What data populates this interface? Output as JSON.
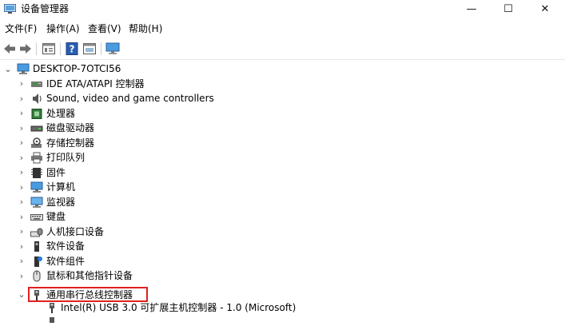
{
  "window": {
    "title": "设备管理器",
    "minimize_glyph": "—",
    "maximize_glyph": "☐",
    "close_glyph": "✕"
  },
  "menu": {
    "items": [
      "文件(F)",
      "操作(A)",
      "查看(V)",
      "帮助(H)"
    ]
  },
  "toolbar": {
    "buttons": [
      "back-arrow-icon",
      "forward-arrow-icon",
      "properties-icon",
      "help-icon",
      "view-icon",
      "monitor-icon"
    ]
  },
  "tree": {
    "root": {
      "label": "DESKTOP-7OTCI56",
      "expanded": true,
      "icon": "computer-icon"
    },
    "categories": [
      {
        "label": "IDE ATA/ATAPI 控制器",
        "icon": "ide-controller-icon"
      },
      {
        "label": "Sound, video and game controllers",
        "icon": "speaker-icon"
      },
      {
        "label": "处理器",
        "icon": "processor-icon"
      },
      {
        "label": "磁盘驱动器",
        "icon": "disk-drive-icon"
      },
      {
        "label": "存储控制器",
        "icon": "storage-controller-icon"
      },
      {
        "label": "打印队列",
        "icon": "printer-icon"
      },
      {
        "label": "固件",
        "icon": "firmware-icon"
      },
      {
        "label": "计算机",
        "icon": "computer-icon"
      },
      {
        "label": "监视器",
        "icon": "monitor-icon"
      },
      {
        "label": "键盘",
        "icon": "keyboard-icon"
      },
      {
        "label": "人机接口设备",
        "icon": "hid-icon"
      },
      {
        "label": "软件设备",
        "icon": "software-device-icon"
      },
      {
        "label": "软件组件",
        "icon": "software-component-icon"
      },
      {
        "label": "鼠标和其他指针设备",
        "icon": "mouse-icon"
      },
      {
        "label": "通用串行总线控制器",
        "icon": "usb-icon",
        "expanded": true,
        "highlighted": true
      }
    ],
    "usb_children": [
      {
        "label": "Intel(R) USB 3.0 可扩展主机控制器 - 1.0 (Microsoft)",
        "icon": "usb-device-icon"
      }
    ]
  },
  "colors": {
    "highlight_border": "#e02020",
    "accent": "#2a7bd4"
  }
}
